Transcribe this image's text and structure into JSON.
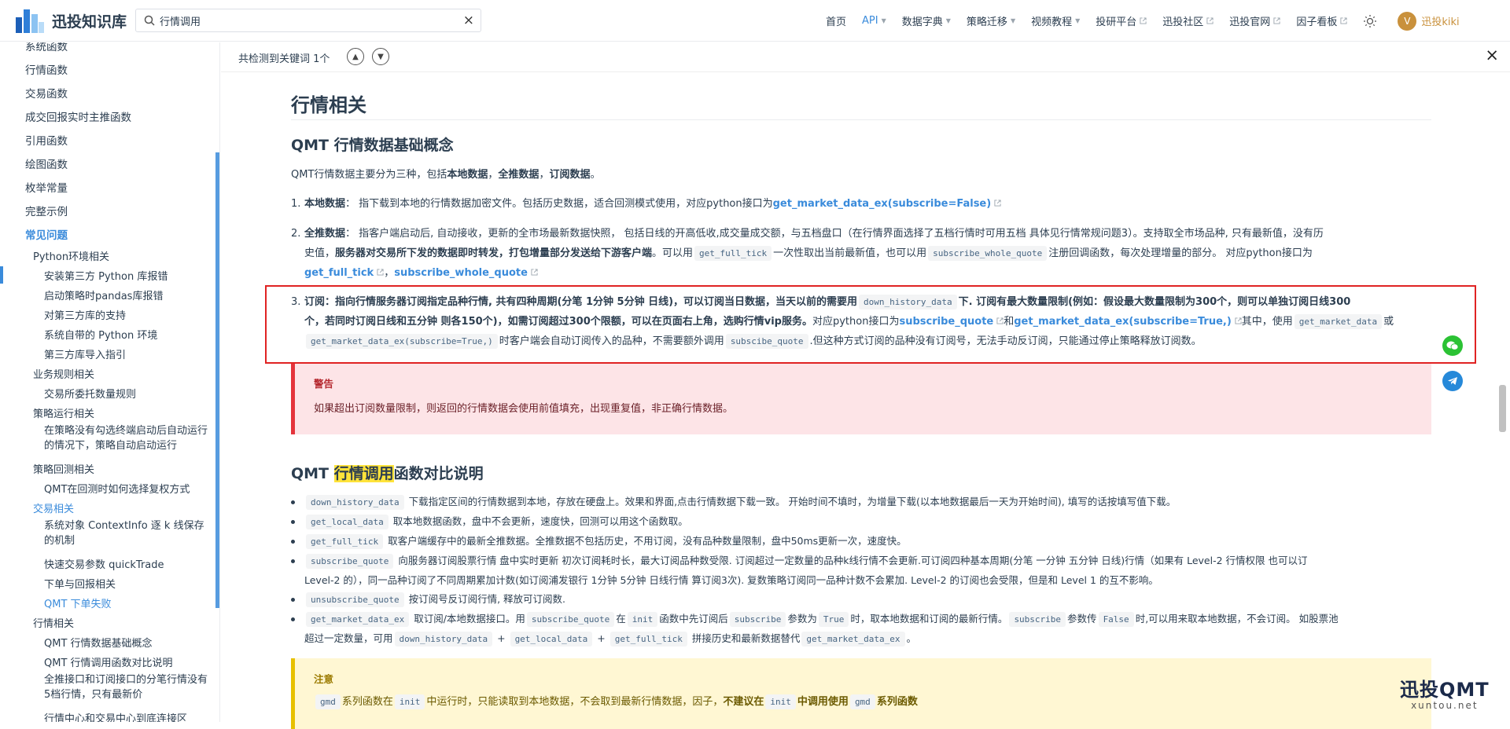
{
  "navbar": {
    "title": "迅投知识库",
    "search_value": "行情调用",
    "clear_glyph": "×",
    "links": [
      {
        "label": "首页"
      },
      {
        "label": "API",
        "caret": "▼"
      },
      {
        "label": "数据字典",
        "caret": "▼"
      },
      {
        "label": "策略迁移",
        "caret": "▼"
      },
      {
        "label": "视频教程",
        "caret": "▼"
      },
      {
        "label": "投研平台"
      },
      {
        "label": "迅投社区"
      },
      {
        "label": "迅投官网"
      },
      {
        "label": "因子看板"
      }
    ],
    "user_initial": "V",
    "user_name": "迅投kiki"
  },
  "sidebar": {
    "items": [
      {
        "label": "系统函数"
      },
      {
        "label": "行情函数"
      },
      {
        "label": "交易函数"
      },
      {
        "label": "成交回报实时主推函数"
      },
      {
        "label": "引用函数"
      },
      {
        "label": "绘图函数"
      },
      {
        "label": "枚举常量"
      },
      {
        "label": "完整示例"
      },
      {
        "label": "常见问题"
      },
      {
        "label": "Python环境相关"
      },
      {
        "label": "安装第三方 Python 库报错"
      },
      {
        "label": "启动策略时pandas库报错"
      },
      {
        "label": "对第三方库的支持"
      },
      {
        "label": "系统自带的 Python 环境"
      },
      {
        "label": "第三方库导入指引"
      },
      {
        "label": "业务规则相关"
      },
      {
        "label": "交易所委托数量规则"
      },
      {
        "label": "策略运行相关"
      },
      {
        "label": "在策略没有勾选终端启动后自动运行的情况下，策略自动启动运行"
      },
      {
        "label": "策略回测相关"
      },
      {
        "label": "QMT在回测时如何选择复权方式"
      },
      {
        "label": "交易相关"
      },
      {
        "label": "系统对象 ContextInfo 逐 k 线保存的机制"
      },
      {
        "label": "快速交易参数 quickTrade"
      },
      {
        "label": "下单与回报相关"
      },
      {
        "label": "QMT 下单失败"
      },
      {
        "label": "行情相关"
      },
      {
        "label": "QMT 行情数据基础概念"
      },
      {
        "label": "QMT 行情调用函数对比说明"
      },
      {
        "label": "全推接口和订阅接口的分笔行情没有5档行情，只有最新价"
      },
      {
        "label": "行情中心和交易中心到底连接区"
      }
    ]
  },
  "findbar": {
    "message": "共检测到关键词 1个",
    "up_glyph": "▲",
    "down_glyph": "▼",
    "close_glyph": "×"
  },
  "content": {
    "h1": "行情相关",
    "h2": "QMT 行情数据基础概念",
    "intro": {
      "a": "QMT行情数据主要分为三种，包括",
      "b": "本地数据",
      "c": "，",
      "d": "全推数据",
      "e": "，",
      "f": "订阅数据",
      "g": "。"
    },
    "item1": {
      "num": "1.",
      "label": "本地数据",
      "text": "：  指下载到本地的行情数据加密文件。包括历史数据，适合回测模式使用，对应python接口为",
      "link": "get_market_data_ex(subscribe=False)"
    },
    "item2": {
      "num": "2.",
      "label": "全推数据",
      "text1": "：  指客户端启动后, 自动接收，更新的全市场最新数据快照，  包括日线的开高低收,成交量成交额，与五档盘口（在行情界面选择了五档行情时可用五档 具体见行情常规问题3）。支持取全市场品种, 只有最新值，没有历",
      "text2a": "史值，",
      "bold2": "服务器对交易所下发的数据即时转发，打包增量部分发送给下游客户端",
      "text2b": "。可以用",
      "code_a": "get_full_tick",
      "text2c": "一次性取出当前最新值，也可以用",
      "code_b": "subscribe_whole_quote",
      "text2d": "注册回调函数，每次处理增量的部分。 对应python接口为",
      "link_a": "get_full_tick",
      "sep": "，",
      "link_b": "subscribe_whole_quote"
    },
    "item3": {
      "num": "3.",
      "label": "订阅",
      "bold1": "：指向行情服务器订阅指定品种行情, 共有四种周期(分笔 1分钟 5分钟 日线)，可以订阅当日数据，当天以前的需要用",
      "code_a": "down_history_data",
      "bold2": "下. 订阅有最大数量限制(例如：假设最大数量限制为300个，则可以单独订阅日线300",
      "bold3": "个，若同时订阅日线和五分钟 则各150个)，如需订阅超过300个限额，可以在页面右上角，选购行情vip服务。",
      "text3a": "对应python接口为",
      "link_a": "subscribe_quote",
      "and": "和",
      "link_b": "get_market_data_ex(subscribe=True,)",
      "text3b": "其中，使用",
      "code_b": "get_market_data",
      "or": "或",
      "code_c": "get_market_data_ex(subscribe=True,)",
      "text3c": "时客户端会自动订阅传入的品种，不需要额外调用",
      "code_d": "subscibe_quote",
      "text3d": ".但这种方式订阅的品种没有订阅号，无法手动反订阅，只能通过停止策略释放订阅数。"
    },
    "warning": {
      "title": "警告",
      "body": "如果超出订阅数量限制，则返回的行情数据会使用前值填充，出现重复值，非正确行情数据。"
    },
    "h3": {
      "a": "QMT ",
      "hl": "行情调用",
      "b": "函数对比说明"
    },
    "bullets": {
      "b1": {
        "code": "down_history_data",
        "text": "下载指定区间的行情数据到本地，存放在硬盘上。效果和界面,点击行情数据下载一致。 开始时间不填时，为增量下载(以本地数据最后一天为开始时间), 填写的话按填写值下载。"
      },
      "b2": {
        "code": "get_local_data",
        "text": "取本地数据函数，盘中不会更新，速度快，回测可以用这个函数取。"
      },
      "b3": {
        "code": "get_full_tick",
        "text": "取客户端缓存中的最新全推数据。全推数据不包括历史，不用订阅，没有品种数量限制，盘中50ms更新一次，速度快。"
      },
      "b4": {
        "code": "subscribe_quote",
        "line1": "向服务器订阅股票行情 盘中实时更新 初次订阅耗时长，最大订阅品种数受限. 订阅超过一定数量的品种k线行情不会更新.可订阅四种基本周期(分笔 一分钟 五分钟 日线)行情（如果有 Level-2 行情权限 也可以订",
        "line2": "Level-2 的），同一品种订阅了不同周期累加计数(如订阅浦发银行 1分钟 5分钟 日线行情 算订阅3次). 复数策略订阅同一品种计数不会累加. Level-2 的订阅也会受限，但是和 Level 1 的互不影响。"
      },
      "b5": {
        "code": "unsubscribe_quote",
        "text": "按订阅号反订阅行情, 释放可订阅数."
      },
      "b6": {
        "code_a": "get_market_data_ex",
        "t1": "取订阅/本地数据接口。用",
        "code_b": "subscribe_quote",
        "t2": "在",
        "code_c": "init",
        "t3": "函数中先订阅后",
        "code_d": "subscribe",
        "t4": "参数为",
        "code_e": "True",
        "t5": "时，取本地数据和订阅的最新行情。",
        "code_f": "subscribe",
        "t6": "参数传",
        "code_g": "False",
        "t7": "时,可以用来取本地数据，不会订阅。 如股票池",
        "t8": "超过一定数量，可用",
        "code_h": "down_history_data",
        "plus1": "+",
        "code_i": "get_local_data",
        "plus2": "+",
        "code_j": "get_full_tick",
        "t9": "拼接历史和最新数据替代",
        "code_k": "get_market_data_ex",
        "t10": "。"
      }
    },
    "note": {
      "title": "注意",
      "code_a": "gmd",
      "t1": "系列函数在",
      "code_b": "init",
      "t2": "中运行时，只能读取到本地数据，不会取到最新行情数据，因子，",
      "bold": "不建议在",
      "code_c": "init",
      "bold2": "中调用使用",
      "code_d": "gmd",
      "bold3": "系列函数"
    }
  },
  "watermark": {
    "line1": "迅投QMT",
    "line2": "xuntou.net"
  },
  "colors": {
    "accent": "#3a8bdb",
    "warning_bg": "#fde4e7",
    "note_bg": "#fff7d3",
    "highlight": "#ffe33a",
    "red_box": "#e02323"
  }
}
